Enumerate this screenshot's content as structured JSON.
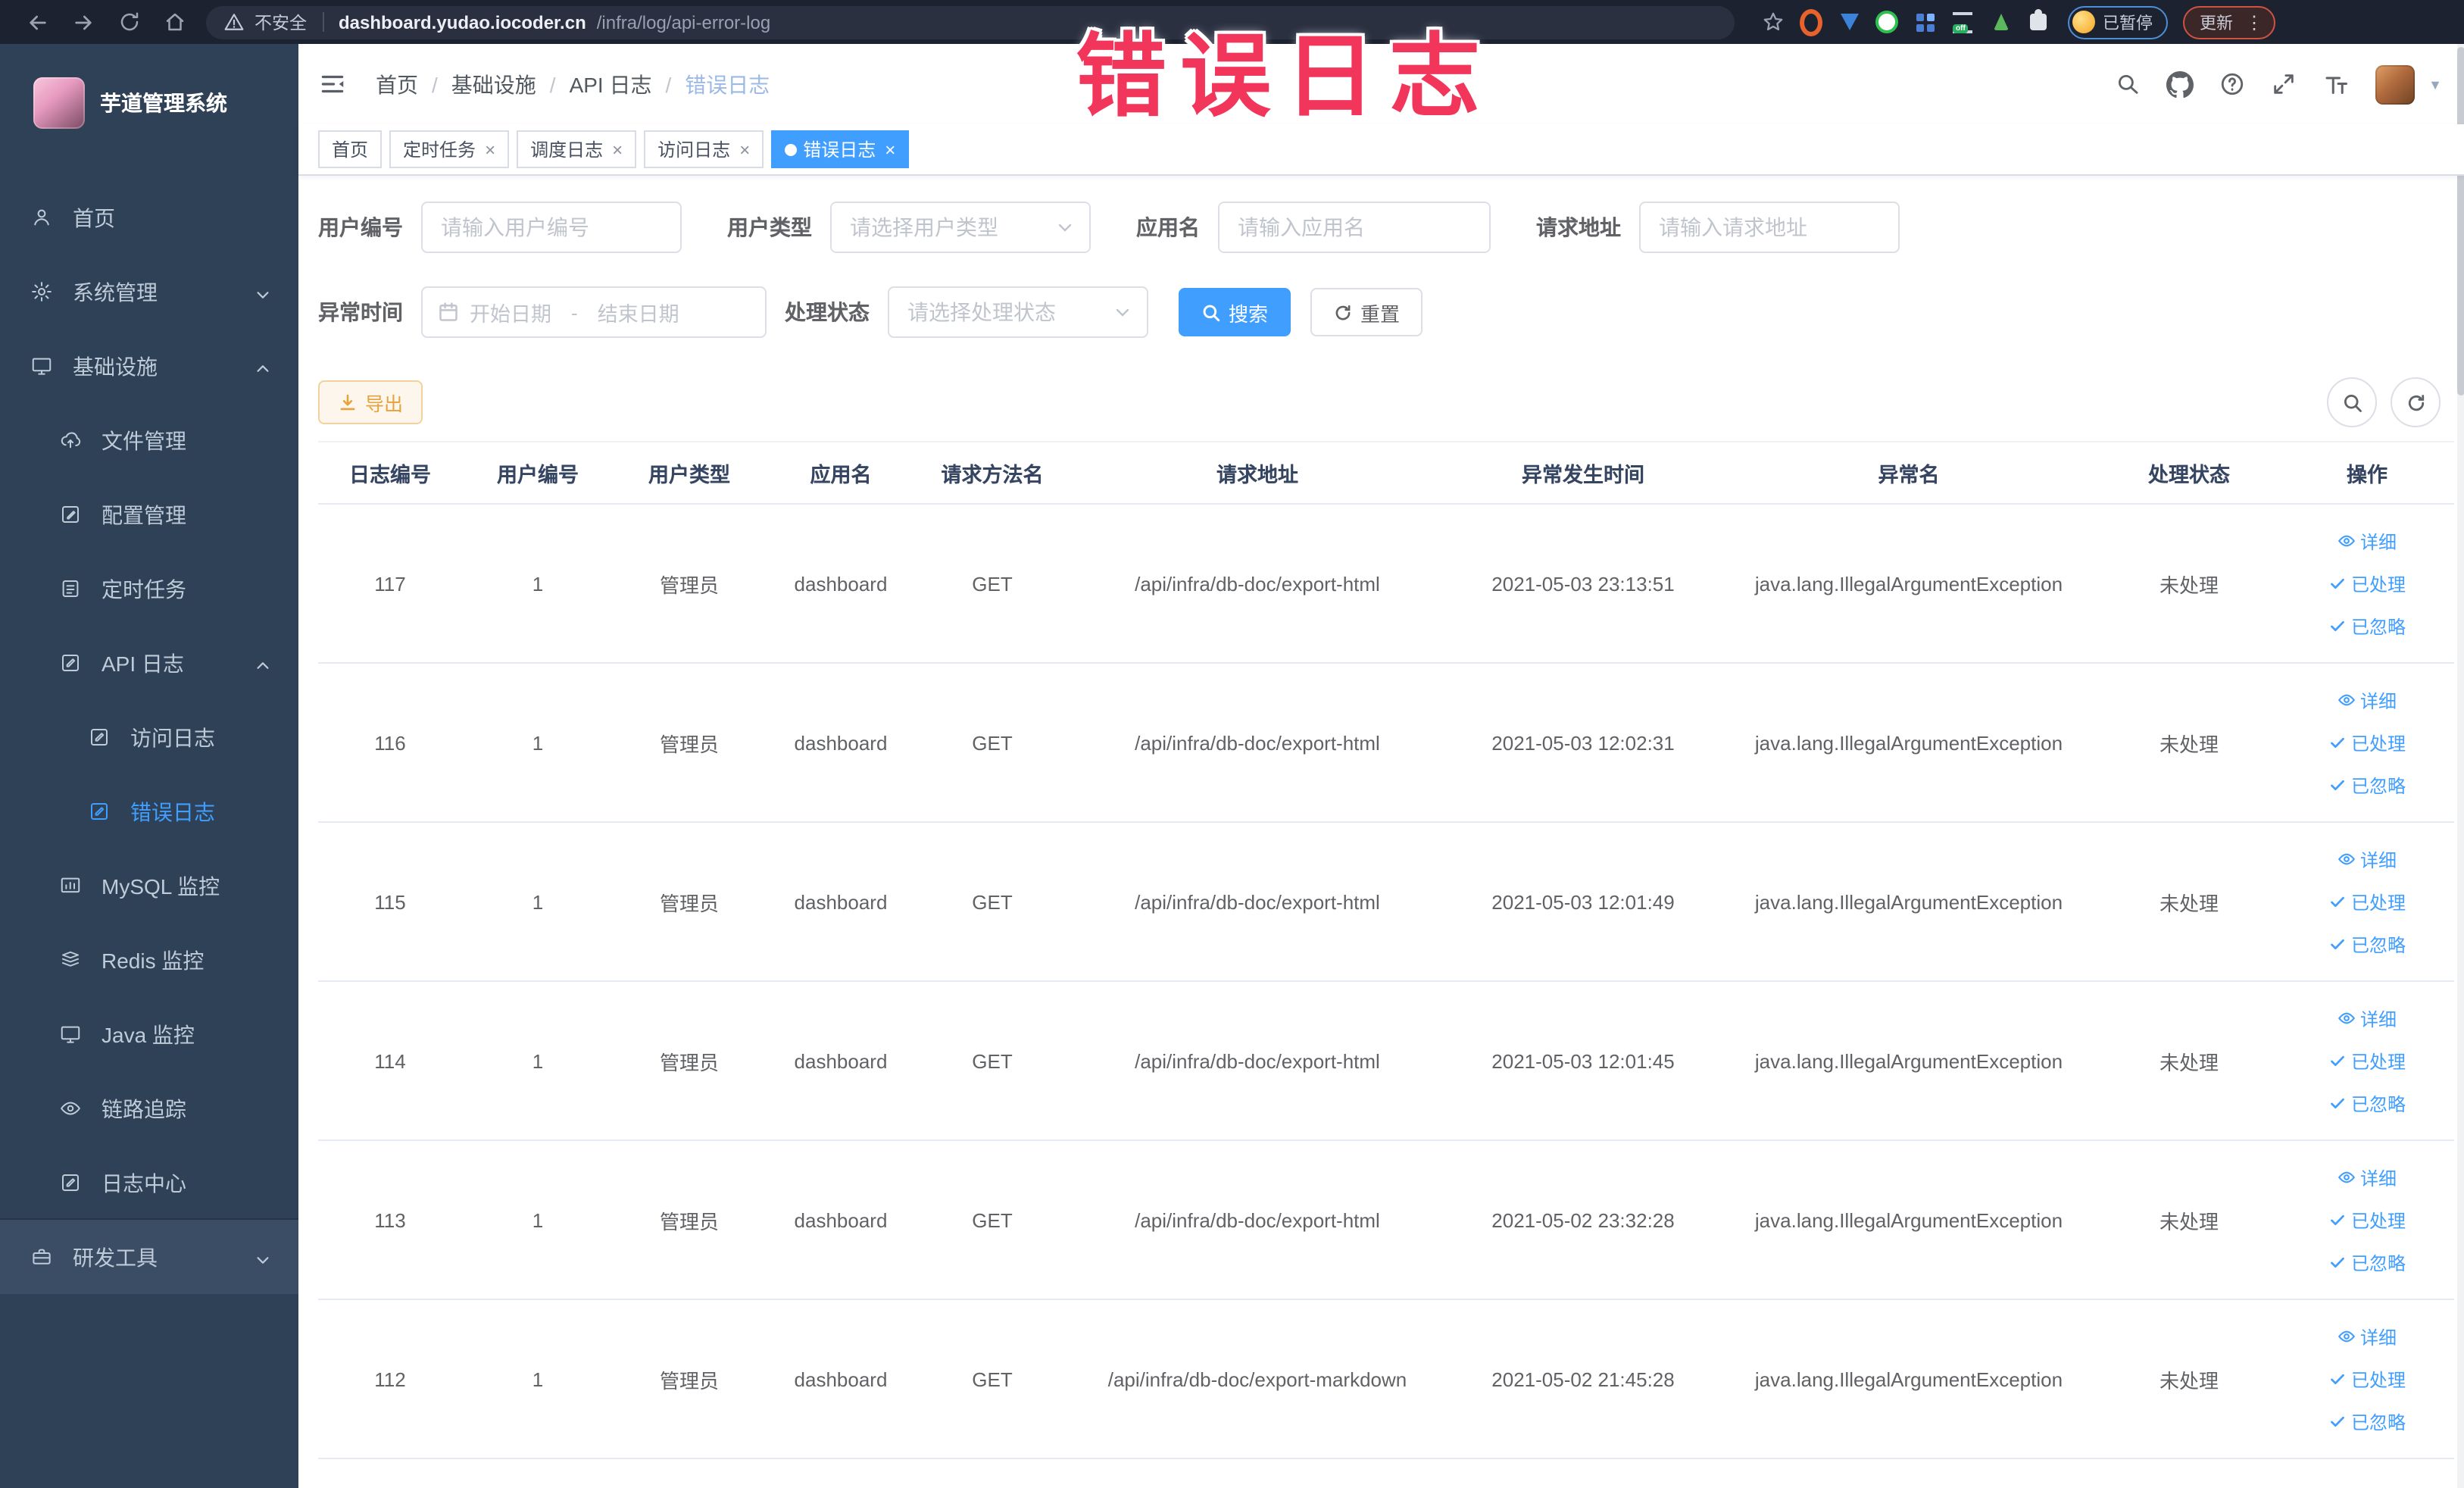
{
  "browser": {
    "security_label": "不安全",
    "url_domain": "dashboard.yudao.iocoder.cn",
    "url_path": "/infra/log/api-error-log",
    "paused_pill_label": "已暂停",
    "update_button_label": "更新"
  },
  "watermark_text": "错误日志",
  "sidebar": {
    "logo_title": "芋道管理系统",
    "items": [
      {
        "key": "home",
        "label": "首页",
        "icon": "user-icon",
        "level": 1
      },
      {
        "key": "system",
        "label": "系统管理",
        "icon": "gear-icon",
        "level": 1,
        "arrow": "down"
      },
      {
        "key": "infra",
        "label": "基础设施",
        "icon": "screen-icon",
        "level": 1,
        "arrow": "up"
      },
      {
        "key": "file",
        "label": "文件管理",
        "icon": "cloud-upload-icon",
        "level": 2
      },
      {
        "key": "config",
        "label": "配置管理",
        "icon": "edit-icon",
        "level": 2
      },
      {
        "key": "job",
        "label": "定时任务",
        "icon": "task-icon",
        "level": 2
      },
      {
        "key": "api-log",
        "label": "API 日志",
        "icon": "log-icon",
        "level": 2,
        "arrow": "up"
      },
      {
        "key": "access-log",
        "label": "访问日志",
        "icon": "log-icon",
        "level": 3
      },
      {
        "key": "error-log",
        "label": "错误日志",
        "icon": "log-icon",
        "level": 3,
        "active": true
      },
      {
        "key": "mysql",
        "label": "MySQL 监控",
        "icon": "chart-icon",
        "level": 2
      },
      {
        "key": "redis",
        "label": "Redis 监控",
        "icon": "stack-icon",
        "level": 2
      },
      {
        "key": "java",
        "label": "Java 监控",
        "icon": "screen-icon",
        "level": 2
      },
      {
        "key": "trace",
        "label": "链路追踪",
        "icon": "eye-icon",
        "level": 2
      },
      {
        "key": "log-center",
        "label": "日志中心",
        "icon": "log-icon",
        "level": 2
      },
      {
        "key": "dev-tools",
        "label": "研发工具",
        "icon": "toolbox-icon",
        "level": 1,
        "arrow": "down",
        "highlighted": true
      }
    ]
  },
  "breadcrumb": [
    "首页",
    "基础设施",
    "API 日志",
    "错误日志"
  ],
  "tags": [
    {
      "key": "home",
      "label": "首页",
      "closable": false,
      "active": false
    },
    {
      "key": "job",
      "label": "定时任务",
      "closable": true,
      "active": false
    },
    {
      "key": "job-log",
      "label": "调度日志",
      "closable": true,
      "active": false
    },
    {
      "key": "access-log",
      "label": "访问日志",
      "closable": true,
      "active": false
    },
    {
      "key": "error-log",
      "label": "错误日志",
      "closable": true,
      "active": true
    }
  ],
  "filters": {
    "user_id_label": "用户编号",
    "user_id_placeholder": "请输入用户编号",
    "user_type_label": "用户类型",
    "user_type_placeholder": "请选择用户类型",
    "app_name_label": "应用名",
    "app_name_placeholder": "请输入应用名",
    "request_url_label": "请求地址",
    "request_url_placeholder": "请输入请求地址",
    "exception_time_label": "异常时间",
    "date_start_placeholder": "开始日期",
    "date_separator": "-",
    "date_end_placeholder": "结束日期",
    "process_status_label": "处理状态",
    "process_status_placeholder": "请选择处理状态",
    "search_button_label": "搜索",
    "reset_button_label": "重置"
  },
  "toolbar": {
    "export_button_label": "导出"
  },
  "table": {
    "columns": [
      "日志编号",
      "用户编号",
      "用户类型",
      "应用名",
      "请求方法名",
      "请求地址",
      "异常发生时间",
      "异常名",
      "处理状态",
      "操作"
    ],
    "action_labels": [
      "详细",
      "已处理",
      "已忽略"
    ],
    "rows": [
      {
        "log_id": "117",
        "user_id": "1",
        "user_type": "管理员",
        "app_name": "dashboard",
        "method": "GET",
        "request_url": "/api/infra/db-doc/export-html",
        "exception_time": "2021-05-03 23:13:51",
        "exception_name": "java.lang.IllegalArgumentException",
        "status": "未处理"
      },
      {
        "log_id": "116",
        "user_id": "1",
        "user_type": "管理员",
        "app_name": "dashboard",
        "method": "GET",
        "request_url": "/api/infra/db-doc/export-html",
        "exception_time": "2021-05-03 12:02:31",
        "exception_name": "java.lang.IllegalArgumentException",
        "status": "未处理"
      },
      {
        "log_id": "115",
        "user_id": "1",
        "user_type": "管理员",
        "app_name": "dashboard",
        "method": "GET",
        "request_url": "/api/infra/db-doc/export-html",
        "exception_time": "2021-05-03 12:01:49",
        "exception_name": "java.lang.IllegalArgumentException",
        "status": "未处理"
      },
      {
        "log_id": "114",
        "user_id": "1",
        "user_type": "管理员",
        "app_name": "dashboard",
        "method": "GET",
        "request_url": "/api/infra/db-doc/export-html",
        "exception_time": "2021-05-03 12:01:45",
        "exception_name": "java.lang.IllegalArgumentException",
        "status": "未处理"
      },
      {
        "log_id": "113",
        "user_id": "1",
        "user_type": "管理员",
        "app_name": "dashboard",
        "method": "GET",
        "request_url": "/api/infra/db-doc/export-html",
        "exception_time": "2021-05-02 23:32:28",
        "exception_name": "java.lang.IllegalArgumentException",
        "status": "未处理"
      },
      {
        "log_id": "112",
        "user_id": "1",
        "user_type": "管理员",
        "app_name": "dashboard",
        "method": "GET",
        "request_url": "/api/infra/db-doc/export-markdown",
        "exception_time": "2021-05-02 21:45:28",
        "exception_name": "java.lang.IllegalArgumentException",
        "status": "未处理"
      }
    ]
  },
  "colors": {
    "accent": "#409eff",
    "sidebar_bg": "#2e4156",
    "watermark": "#f2355b",
    "export_text": "#e6a23c",
    "export_bg": "#fdf6ec",
    "export_border": "#f3d19e",
    "active_tag_bg": "#409eff"
  }
}
